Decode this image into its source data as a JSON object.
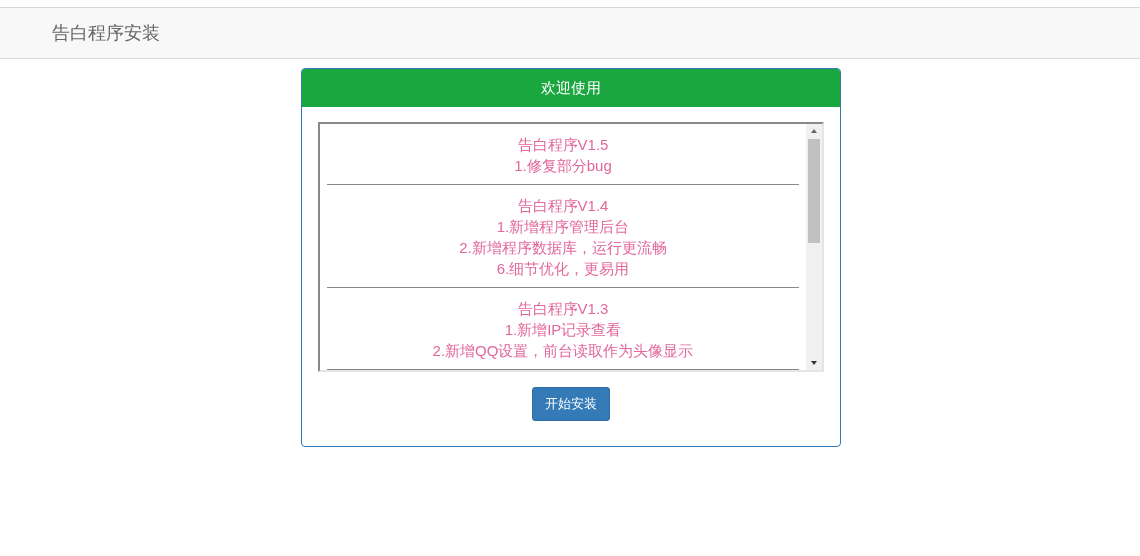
{
  "navbar": {
    "title": "告白程序安装"
  },
  "panel": {
    "title": "欢迎使用",
    "changelog": [
      {
        "version": "告白程序V1.5",
        "notes": [
          "1.修复部分bug"
        ]
      },
      {
        "version": "告白程序V1.4",
        "notes": [
          "1.新增程序管理后台",
          "2.新增程序数据库，运行更流畅",
          "6.细节优化，更易用"
        ]
      },
      {
        "version": "告白程序V1.3",
        "notes": [
          "1.新增IP记录查看",
          "2.新增QQ设置，前台读取作为头像显示"
        ]
      }
    ],
    "button": "开始安装"
  }
}
